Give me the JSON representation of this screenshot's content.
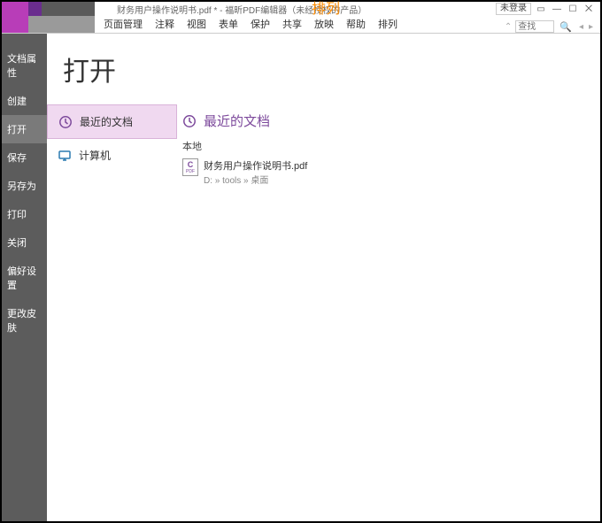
{
  "titlebar": {
    "doc_title": "财务用户操作说明书.pdf * - 福昕PDF编辑器（未经授权的产品）",
    "special_tab": "排列",
    "not_logged_in": "未登录"
  },
  "ribbon": {
    "tabs": [
      "页面管理",
      "注释",
      "视图",
      "表单",
      "保护",
      "共享",
      "放映",
      "帮助",
      "排列"
    ],
    "search_placeholder": "查找"
  },
  "sidebar": {
    "items": [
      {
        "label": "文档属性"
      },
      {
        "label": "创建"
      },
      {
        "label": "打开"
      },
      {
        "label": "保存"
      },
      {
        "label": "另存为"
      },
      {
        "label": "打印"
      },
      {
        "label": "关闭"
      },
      {
        "label": "偏好设置"
      },
      {
        "label": "更改皮肤"
      }
    ],
    "active_index": 2
  },
  "main": {
    "title": "打开",
    "sources": {
      "recent": "最近的文档",
      "computer": "计算机"
    },
    "section_header": "最近的文档",
    "local_label": "本地",
    "file": {
      "name": "财务用户操作说明书.pdf",
      "path": "D: » tools » 桌面"
    }
  }
}
